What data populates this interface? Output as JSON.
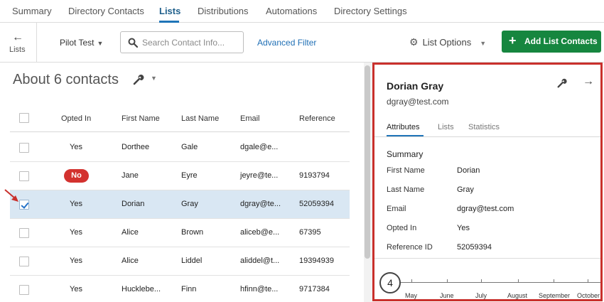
{
  "top_tabs": [
    {
      "label": "Summary"
    },
    {
      "label": "Directory Contacts"
    },
    {
      "label": "Lists"
    },
    {
      "label": "Distributions"
    },
    {
      "label": "Automations"
    },
    {
      "label": "Directory Settings"
    }
  ],
  "toolbar": {
    "back_label": "Lists",
    "back_icon": "arrow-left-icon",
    "list_name": "Pilot Test",
    "search_placeholder": "Search Contact Info...",
    "advanced_filter": "Advanced Filter",
    "list_options": "List Options",
    "add_button": "Add List Contacts"
  },
  "list": {
    "count_title": "About 6 contacts",
    "columns": [
      "Opted In",
      "First Name",
      "Last Name",
      "Email",
      "Reference"
    ],
    "rows": [
      {
        "opted_in": "Yes",
        "first": "Dorthee",
        "last": "Gale",
        "email": "dgale@e...",
        "reference": "",
        "checked": false
      },
      {
        "opted_in": "No",
        "first": "Jane",
        "last": "Eyre",
        "email": "jeyre@te...",
        "reference": "9193794",
        "checked": false
      },
      {
        "opted_in": "Yes",
        "first": "Dorian",
        "last": "Gray",
        "email": "dgray@te...",
        "reference": "52059394",
        "checked": true
      },
      {
        "opted_in": "Yes",
        "first": "Alice",
        "last": "Brown",
        "email": "aliceb@e...",
        "reference": "67395",
        "checked": false
      },
      {
        "opted_in": "Yes",
        "first": "Alice",
        "last": "Liddel",
        "email": "aliddel@t...",
        "reference": "19394939",
        "checked": false
      },
      {
        "opted_in": "Yes",
        "first": "Hucklebe...",
        "last": "Finn",
        "email": "hfinn@te...",
        "reference": "9717384",
        "checked": false
      }
    ]
  },
  "panel": {
    "name": "Dorian Gray",
    "email": "dgray@test.com",
    "tabs": [
      {
        "label": "Attributes"
      },
      {
        "label": "Lists"
      },
      {
        "label": "Statistics"
      }
    ],
    "summary_heading": "Summary",
    "attributes": [
      {
        "label": "First Name",
        "value": "Dorian"
      },
      {
        "label": "Last Name",
        "value": "Gray"
      },
      {
        "label": "Email",
        "value": "dgray@test.com"
      },
      {
        "label": "Opted In",
        "value": "Yes"
      },
      {
        "label": "Reference ID",
        "value": "52059394"
      }
    ],
    "timeline": {
      "count": "4",
      "months": [
        "May",
        "June",
        "July",
        "August",
        "September",
        "October"
      ]
    }
  },
  "colors": {
    "accent": "#1f75b8",
    "add_button": "#16863f",
    "no_badge": "#d3322f",
    "panel_border": "#c9302c",
    "selected_row": "#d9e7f3"
  }
}
